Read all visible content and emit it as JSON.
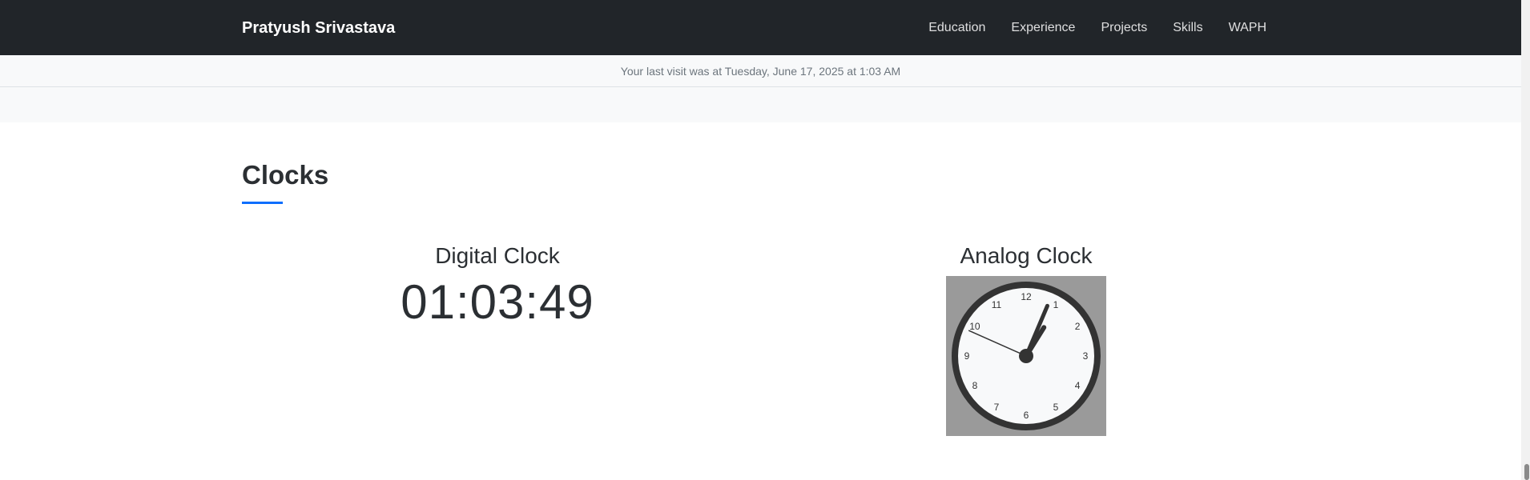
{
  "navbar": {
    "brand": "Pratyush Srivastava",
    "links": [
      "Education",
      "Experience",
      "Projects",
      "Skills",
      "WAPH"
    ]
  },
  "visit": {
    "text": "Your last visit was at Tuesday, June 17, 2025 at 1:03 AM"
  },
  "section": {
    "title": "Clocks"
  },
  "digital_clock": {
    "heading": "Digital Clock",
    "time": "01:03:49"
  },
  "analog_clock": {
    "heading": "Analog Clock",
    "numbers": [
      "12",
      "1",
      "2",
      "3",
      "4",
      "5",
      "6",
      "7",
      "8",
      "9",
      "10",
      "11"
    ],
    "time": {
      "hours": 1,
      "minutes": 3,
      "seconds": 49
    },
    "colors": {
      "background": "#9a9a9a",
      "face": "#f8f9fa",
      "rim": "#333333",
      "hands": "#333333"
    }
  }
}
